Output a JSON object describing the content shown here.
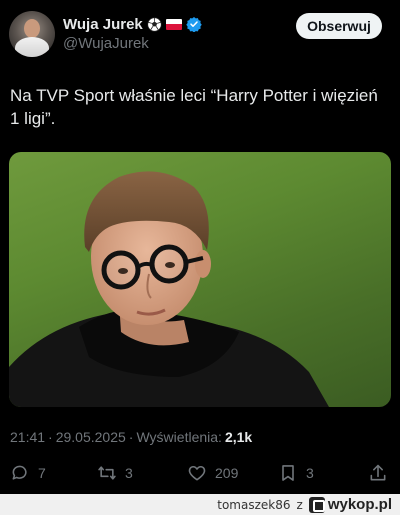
{
  "author": {
    "display_name": "Wuja Jurek",
    "handle": "@WujaJurek",
    "badges": [
      "soccer-ball-icon",
      "poland-flag-icon",
      "verified-icon"
    ]
  },
  "follow_button": {
    "label": "Obserwuj"
  },
  "tweet": {
    "text": "Na TVP Sport właśnie leci “Harry Potter i więzień 1 ligi”."
  },
  "meta": {
    "time": "21:41",
    "separator": "·",
    "date": "29.05.2025",
    "views_label": "Wyświetlenia:",
    "views_count": "2,1k"
  },
  "actions": {
    "replies": "7",
    "reposts": "3",
    "likes": "209",
    "bookmarks": "3"
  },
  "watermark": {
    "user": "tomaszek86",
    "z": "z",
    "site": "wykop.pl"
  },
  "colors": {
    "background": "#000000",
    "text": "#e7e9ea",
    "muted": "#71767b",
    "verified": "#1d9bf0",
    "follow_button_bg": "#eff3f4"
  }
}
